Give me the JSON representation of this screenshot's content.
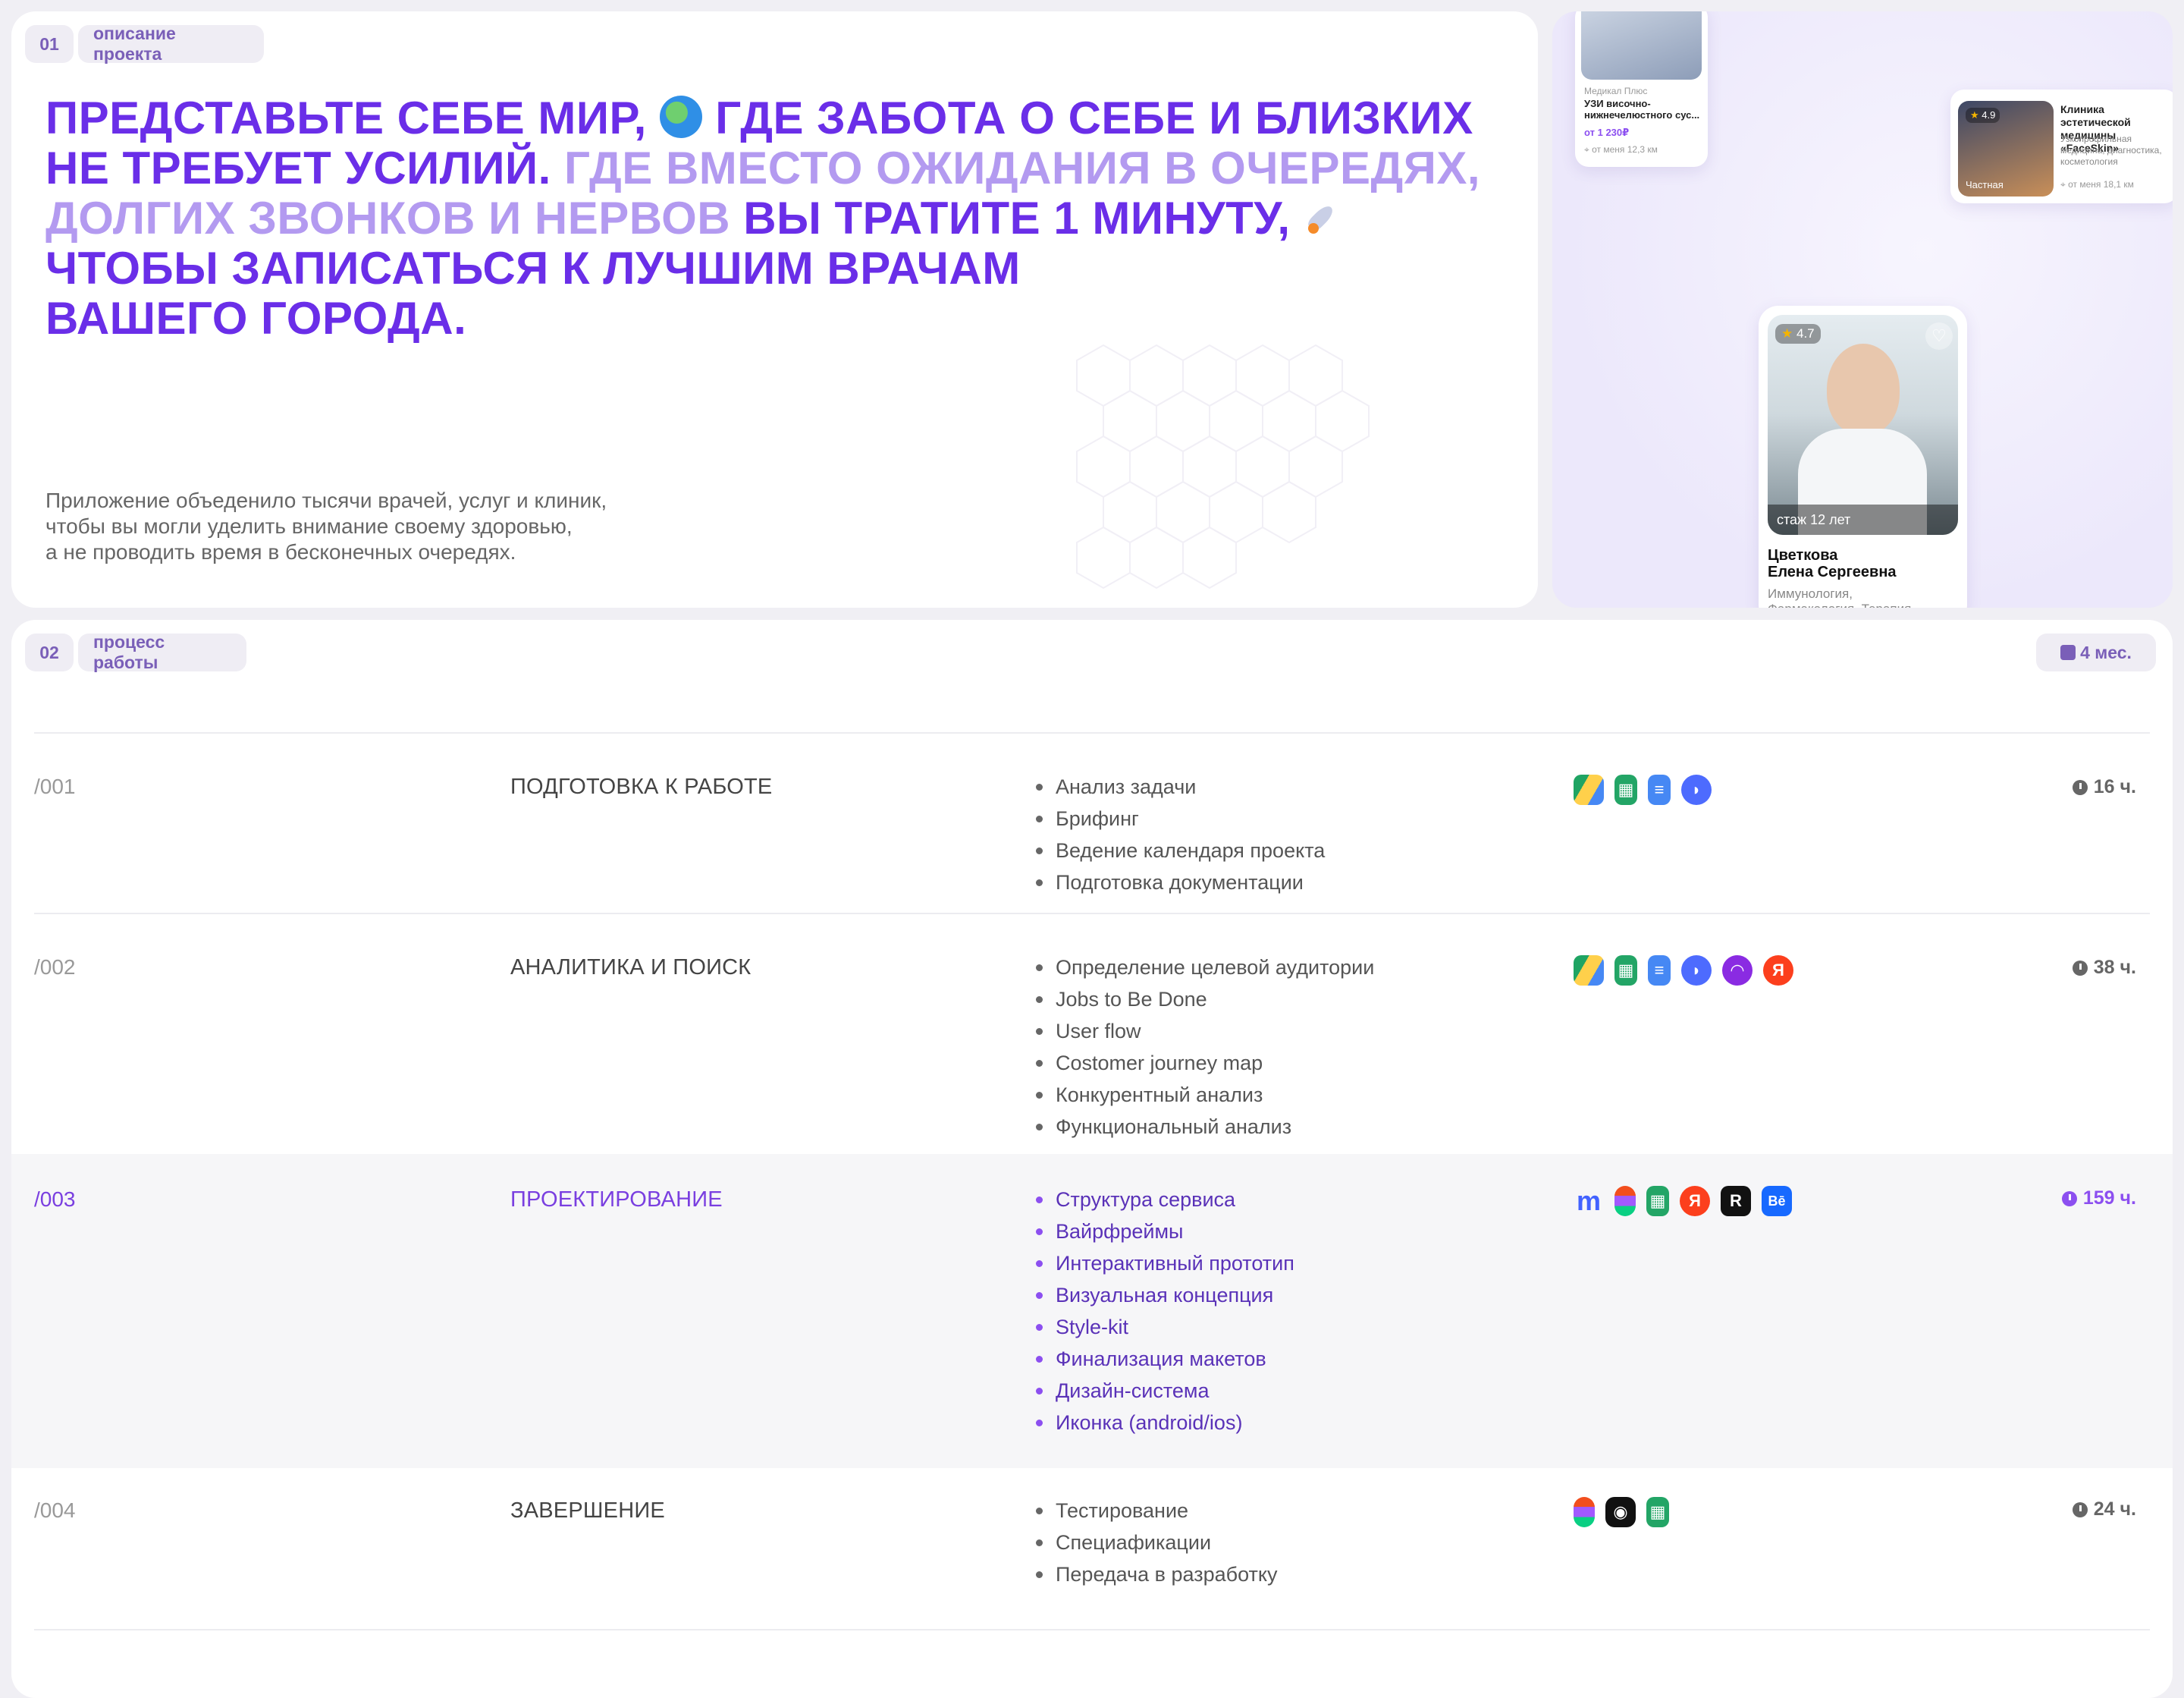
{
  "intro": {
    "index": "01",
    "section_label": "описание проекта",
    "headline": {
      "part1": "Представьте себе мир,",
      "part2": "где забота о себе и близких не требует усилий.",
      "part3_light": "Где вместо ожидания в очередях, долгих звонков и нервов",
      "part4": "вы тратите 1 минуту,",
      "part5": "чтобы записаться к лучшим врачам",
      "part6": "вашего города."
    },
    "description": [
      "Приложение объеденило тысячи врачей, услуг и клиник,",
      "чтобы вы могли уделить внимание своему здоровью,",
      "а не проводить время в бесконечных очередях."
    ]
  },
  "preview": {
    "service_card": {
      "clinic": "Медикал Плюс",
      "title": "УЗИ височно-нижнечелюстного сус...",
      "price": "от 1 230₽",
      "distance": "от меня 12,3 км"
    },
    "clinic_card": {
      "rating": "4.9",
      "badge": "Частная",
      "title": "Клиника эстетической медицины «FaceSkin»",
      "subtitle": "Узкопрофильная медицина, диагностика, косметология",
      "distance": "от меня 18,1 км"
    },
    "doctor_card": {
      "rating": "4.7",
      "experience": "стаж 12 лет",
      "name_line1": "Цветкова",
      "name_line2": "Елена Сергеевна",
      "specialty_line1": "Иммунология,",
      "specialty_line2": "Фармакология, Терапия"
    }
  },
  "process": {
    "index": "02",
    "section_label": "процесс работы",
    "duration": "4 мес.",
    "rows": [
      {
        "num": "/001",
        "title": "Подготовка к работе",
        "tasks": [
          "Анализ задачи",
          "Брифинг",
          "Ведение календаря проекта",
          "Подготовка документации"
        ],
        "tools": [
          "google-drive-icon",
          "google-sheets-icon",
          "google-docs-icon",
          "deepseek-icon"
        ],
        "hours": "16 ч."
      },
      {
        "num": "/002",
        "title": "Аналитика и поиск",
        "tasks": [
          "Определение целевой аудитории",
          "Jobs to Be Done",
          "User flow",
          "Costomer journey map",
          "Конкурентный анализ",
          "Функциональный анализ"
        ],
        "tools": [
          "google-drive-icon",
          "google-sheets-icon",
          "google-docs-icon",
          "deepseek-icon",
          "alice-icon",
          "yandex-icon"
        ],
        "hours": "38 ч."
      },
      {
        "num": "/003",
        "title": "Проектирование",
        "tasks": [
          "Структура сервиса",
          "Вайрфреймы",
          "Интерактивный прототип",
          "Визуальная концепция",
          "Style-kit",
          "Финализация макетов",
          "Дизайн-система",
          "Иконка (android/ios)"
        ],
        "tools": [
          "miro-icon",
          "figma-icon",
          "google-sheets-icon",
          "yandex-icon",
          "pinterest-icon",
          "behance-icon"
        ],
        "hours": "159 ч."
      },
      {
        "num": "/004",
        "title": "Завершение",
        "tasks": [
          "Тестирование",
          "Специафикации",
          "Передача в разработку"
        ],
        "tools": [
          "figma-icon",
          "loom-icon",
          "google-sheets-icon"
        ],
        "hours": "24 ч."
      }
    ]
  },
  "colors": {
    "accent": "#6a2ee8",
    "accent_light": "#b39af0",
    "active_row": "#7a3fe0",
    "chip_bg": "#efedf4"
  }
}
